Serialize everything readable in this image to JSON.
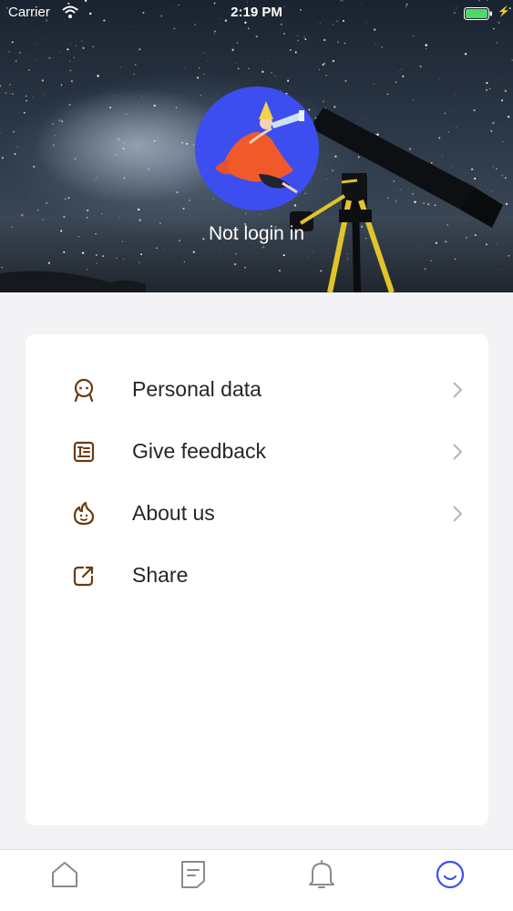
{
  "status_bar": {
    "carrier": "Carrier",
    "time": "2:19 PM",
    "wifi_icon": "wifi-icon",
    "battery_icon": "battery-full-icon"
  },
  "profile": {
    "avatar_icon": "astronomer-illustration-avatar",
    "login_label": "Not login in"
  },
  "menu": {
    "items": [
      {
        "label": "Personal data",
        "icon": "person-face-icon",
        "has_chevron": true
      },
      {
        "label": "Give feedback",
        "icon": "feedback-form-icon",
        "has_chevron": true
      },
      {
        "label": "About us",
        "icon": "flame-smile-icon",
        "has_chevron": true
      },
      {
        "label": "Share",
        "icon": "share-external-icon",
        "has_chevron": false
      }
    ]
  },
  "tab_bar": {
    "tabs": [
      {
        "name": "home",
        "icon": "home-icon",
        "active": false
      },
      {
        "name": "notes",
        "icon": "document-icon",
        "active": false
      },
      {
        "name": "notifications",
        "icon": "bell-icon",
        "active": false
      },
      {
        "name": "profile",
        "icon": "smile-icon",
        "active": true
      }
    ]
  },
  "colors": {
    "accent": "#3d4ef0",
    "menu_icon": "#6b3a10",
    "tab_inactive": "#8a8a8a",
    "tab_active": "#3d4ef0",
    "card_bg": "#ffffff",
    "page_bg": "#f3f3f5",
    "battery": "#4cd964"
  }
}
